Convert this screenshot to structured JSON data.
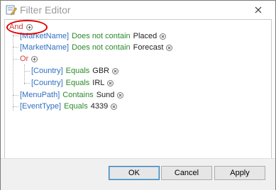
{
  "window": {
    "title": "Filter Editor"
  },
  "tree": {
    "root": {
      "label": "And"
    },
    "conditions": [
      {
        "field": "[MarketName]",
        "operator": "Does not contain",
        "value": "Placed"
      },
      {
        "field": "[MarketName]",
        "operator": "Does not contain",
        "value": "Forecast"
      }
    ],
    "or_group": {
      "label": "Or",
      "conditions": [
        {
          "field": "[Country]",
          "operator": "Equals",
          "value": "GBR"
        },
        {
          "field": "[Country]",
          "operator": "Equals",
          "value": "IRL"
        }
      ]
    },
    "more_conditions": [
      {
        "field": "[MenuPath]",
        "operator": "Contains",
        "value": "Sund"
      },
      {
        "field": "[EventType]",
        "operator": "Equals",
        "value": "4339"
      }
    ]
  },
  "buttons": {
    "ok": "OK",
    "cancel": "Cancel",
    "apply": "Apply"
  },
  "colors": {
    "group": "#d04040",
    "field": "#2f6fc0",
    "operator": "#2a8a2a",
    "highlight": "#e00000"
  }
}
